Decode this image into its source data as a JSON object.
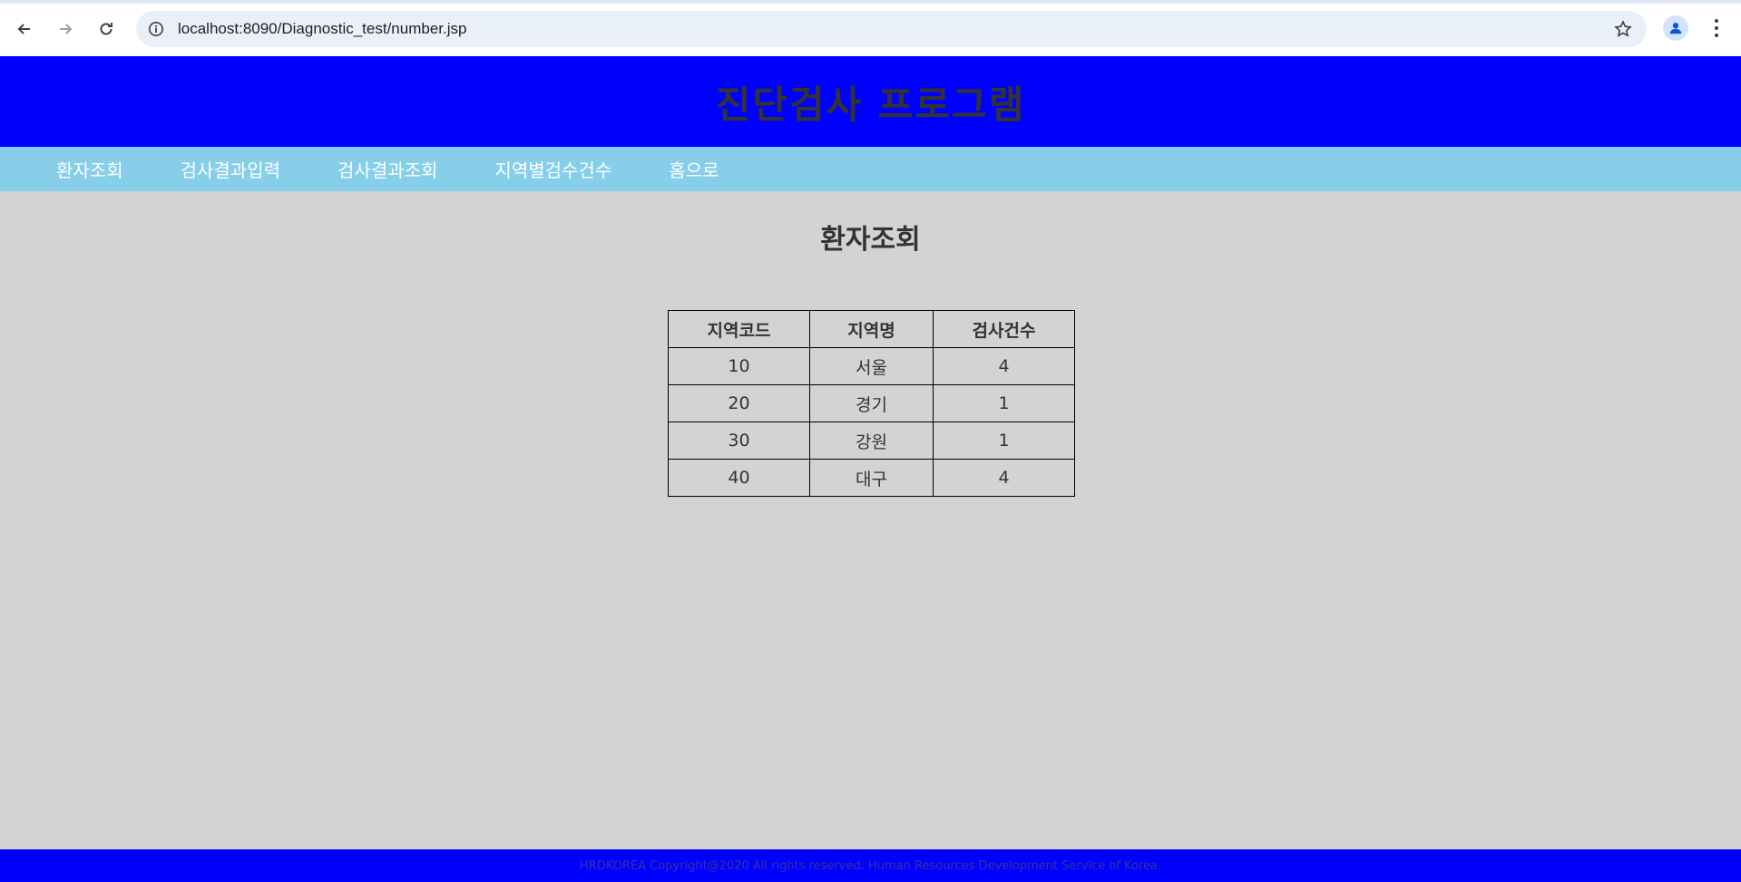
{
  "browser": {
    "url": "localhost:8090/Diagnostic_test/number.jsp"
  },
  "header": {
    "title": "진단검사 프로그램"
  },
  "nav": {
    "items": [
      "환자조회",
      "검사결과입력",
      "검사결과조회",
      "지역별검수건수",
      "홈으로"
    ]
  },
  "main": {
    "heading": "환자조회",
    "table": {
      "columns": [
        "지역코드",
        "지역명",
        "검사건수"
      ],
      "rows": [
        [
          "10",
          "서울",
          "4"
        ],
        [
          "20",
          "경기",
          "1"
        ],
        [
          "30",
          "강원",
          "1"
        ],
        [
          "40",
          "대구",
          "4"
        ]
      ]
    }
  },
  "footer": {
    "text": "HRDKOREA Copyright@2020 All rights reserved. Human Resources Development Service of Korea."
  },
  "colors": {
    "header_bg": "#0000ff",
    "nav_bg": "#87ceeb",
    "page_bg": "#d3d3d3"
  }
}
